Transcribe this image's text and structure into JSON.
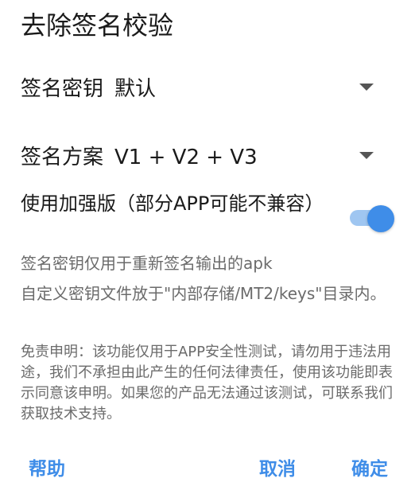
{
  "dialog": {
    "title": "去除签名校验",
    "key_row": {
      "label": "签名密钥",
      "value": "默认"
    },
    "scheme_row": {
      "label": "签名方案",
      "value": "V1 + V2 + V3"
    },
    "enhanced_switch": {
      "label": "使用加强版（部分APP可能不兼容）",
      "checked": true
    },
    "info_lines": [
      "签名密钥仅用于重新签名输出的apk",
      "自定义密钥文件放于\"内部存储/MT2/keys\"目录内。"
    ],
    "disclaimer": "免责申明：该功能仅用于APP安全性测试，请勿用于违法用途，我们不承担由此产生的任何法律责任，使用该功能即表示同意该申明。如果您的产品无法通过该测试，可联系我们获取技术支持。",
    "buttons": {
      "help": "帮助",
      "cancel": "取消",
      "confirm": "确定"
    },
    "colors": {
      "accent": "#3f8de8",
      "switch_track": "#9fc6f1",
      "primary_text": "#1a1a1a",
      "secondary_text": "#6b6b6b"
    }
  }
}
